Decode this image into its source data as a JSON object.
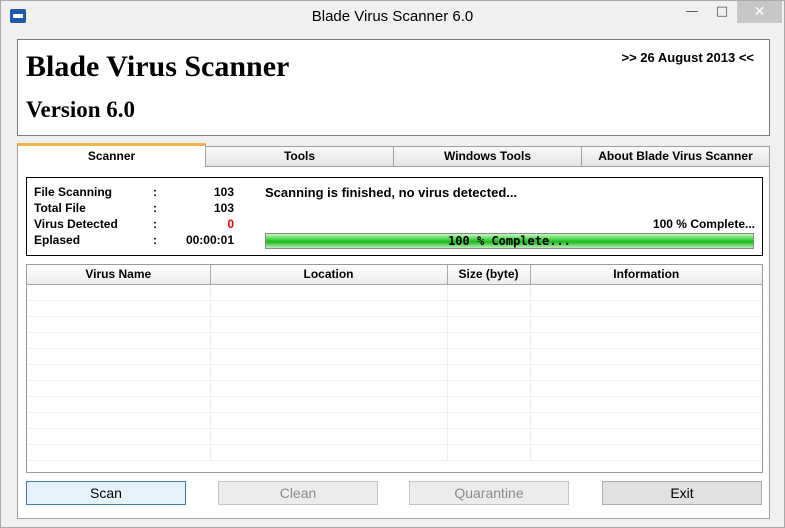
{
  "window": {
    "title": "Blade Virus Scanner 6.0",
    "min_glyph": "—",
    "max_glyph": "□",
    "close_glyph": "✕"
  },
  "header": {
    "app_name": "Blade Virus Scanner",
    "version": "Version 6.0",
    "date": ">> 26 August 2013 <<"
  },
  "tabs": [
    {
      "label": "Scanner",
      "active": true
    },
    {
      "label": "Tools",
      "active": false
    },
    {
      "label": "Windows Tools",
      "active": false
    },
    {
      "label": "About Blade Virus Scanner",
      "active": false
    }
  ],
  "stats": {
    "file_scanning": {
      "label": "File Scanning",
      "value": "103"
    },
    "total_file": {
      "label": "Total File",
      "value": "103"
    },
    "virus_detected": {
      "label": "Virus Detected",
      "value": "0"
    },
    "elapsed": {
      "label": "Eplased",
      "value": "00:00:01"
    },
    "colon": ":"
  },
  "status": {
    "message": "Scanning is finished, no virus detected...",
    "complete_label": "100 % Complete...",
    "progress_text": "100 % Complete...",
    "progress_fraction": 1.0
  },
  "table": {
    "columns": [
      "Virus Name",
      "Location",
      "Size (byte)",
      "Information"
    ]
  },
  "buttons": {
    "scan": "Scan",
    "clean": "Clean",
    "quarantine": "Quarantine",
    "exit": "Exit"
  },
  "colors": {
    "tab_accent": "#f0b64a",
    "progress_green": "#2fd12f",
    "virus_count_red": "#e00000"
  }
}
